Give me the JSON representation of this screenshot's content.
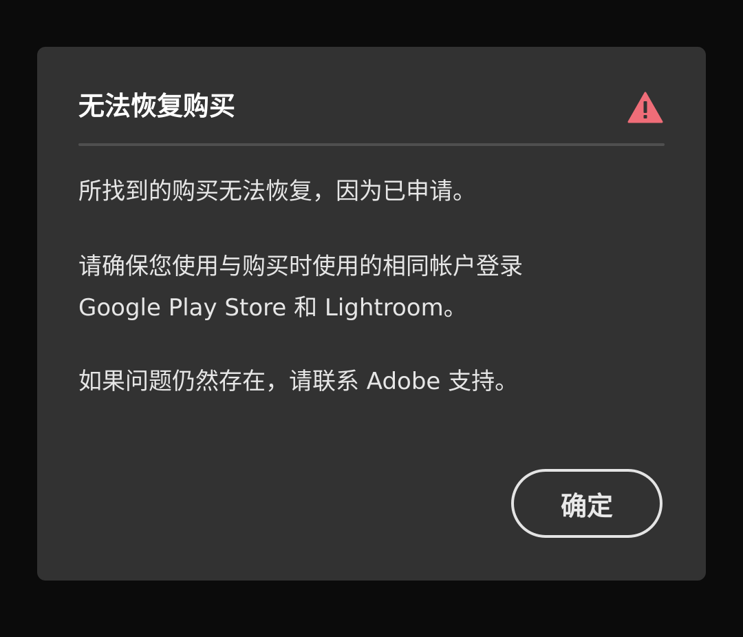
{
  "dialog": {
    "title": "无法恢复购买",
    "warning_icon": "alert-triangle-icon",
    "warning_color": "#ef6d78",
    "paragraphs": [
      "所找到的购买无法恢复，因为已申请。",
      "请确保您使用与购买时使用的相同帐户登录",
      "Google Play Store 和 Lightroom。",
      "如果问题仍然存在，请联系 Adobe 支持。"
    ],
    "ok_label": "确定"
  }
}
